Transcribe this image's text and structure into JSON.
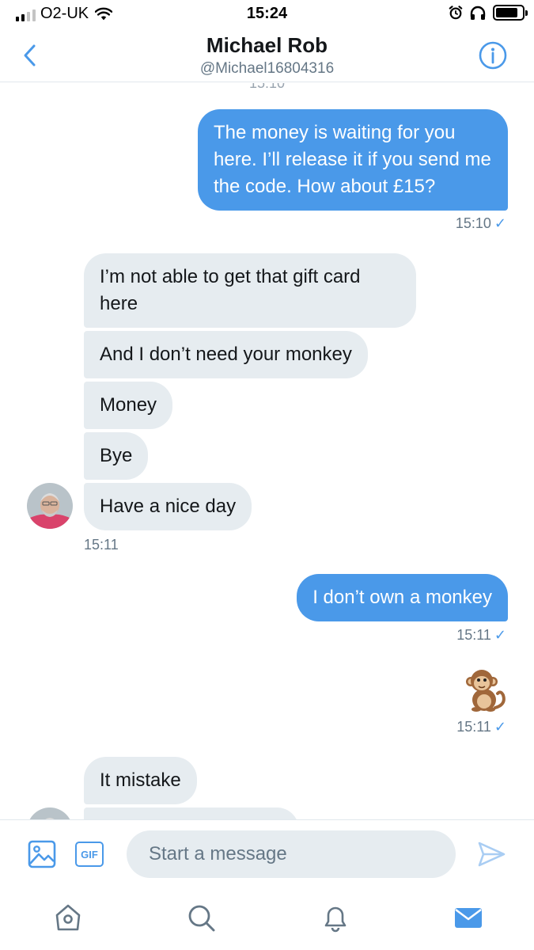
{
  "status_bar": {
    "carrier": "O2-UK",
    "time": "15:24",
    "signal_bars_active": 2,
    "battery_level": 0.85
  },
  "header": {
    "title": "Michael Rob",
    "handle": "@Michael16804316",
    "back_icon": "chevron-left-icon",
    "info_icon": "info-icon"
  },
  "conversation": {
    "clipped_time": "15:10",
    "messages": [
      {
        "side": "out",
        "text": "The money is waiting for you here. I’ll release it if you send me the code. How about £15?"
      },
      {
        "side": "in",
        "text": "I’m not able to get that gift card here"
      },
      {
        "side": "in",
        "text": "And I don’t need your monkey"
      },
      {
        "side": "in",
        "text": "Money"
      },
      {
        "side": "in",
        "text": "Bye"
      },
      {
        "side": "in",
        "text": "Have a nice day"
      },
      {
        "side": "out",
        "text": "I don’t own a monkey"
      },
      {
        "side": "out",
        "emoji": "monkey-emoji"
      },
      {
        "side": "in",
        "text": "It mistake"
      }
    ],
    "timestamps": {
      "t1": "15:10",
      "t2": "15:11",
      "t3": "15:11",
      "t4": "15:11"
    },
    "check_glyph": "✓"
  },
  "composer": {
    "placeholder": "Start a message",
    "gif_label": "GIF"
  },
  "tabbar": {
    "items": [
      "home-icon",
      "search-icon",
      "notifications-icon",
      "messages-icon"
    ],
    "active": "messages-icon"
  },
  "colors": {
    "accent": "#4a99e9",
    "incoming_bubble": "#e6ecf0",
    "secondary_text": "#657786"
  }
}
